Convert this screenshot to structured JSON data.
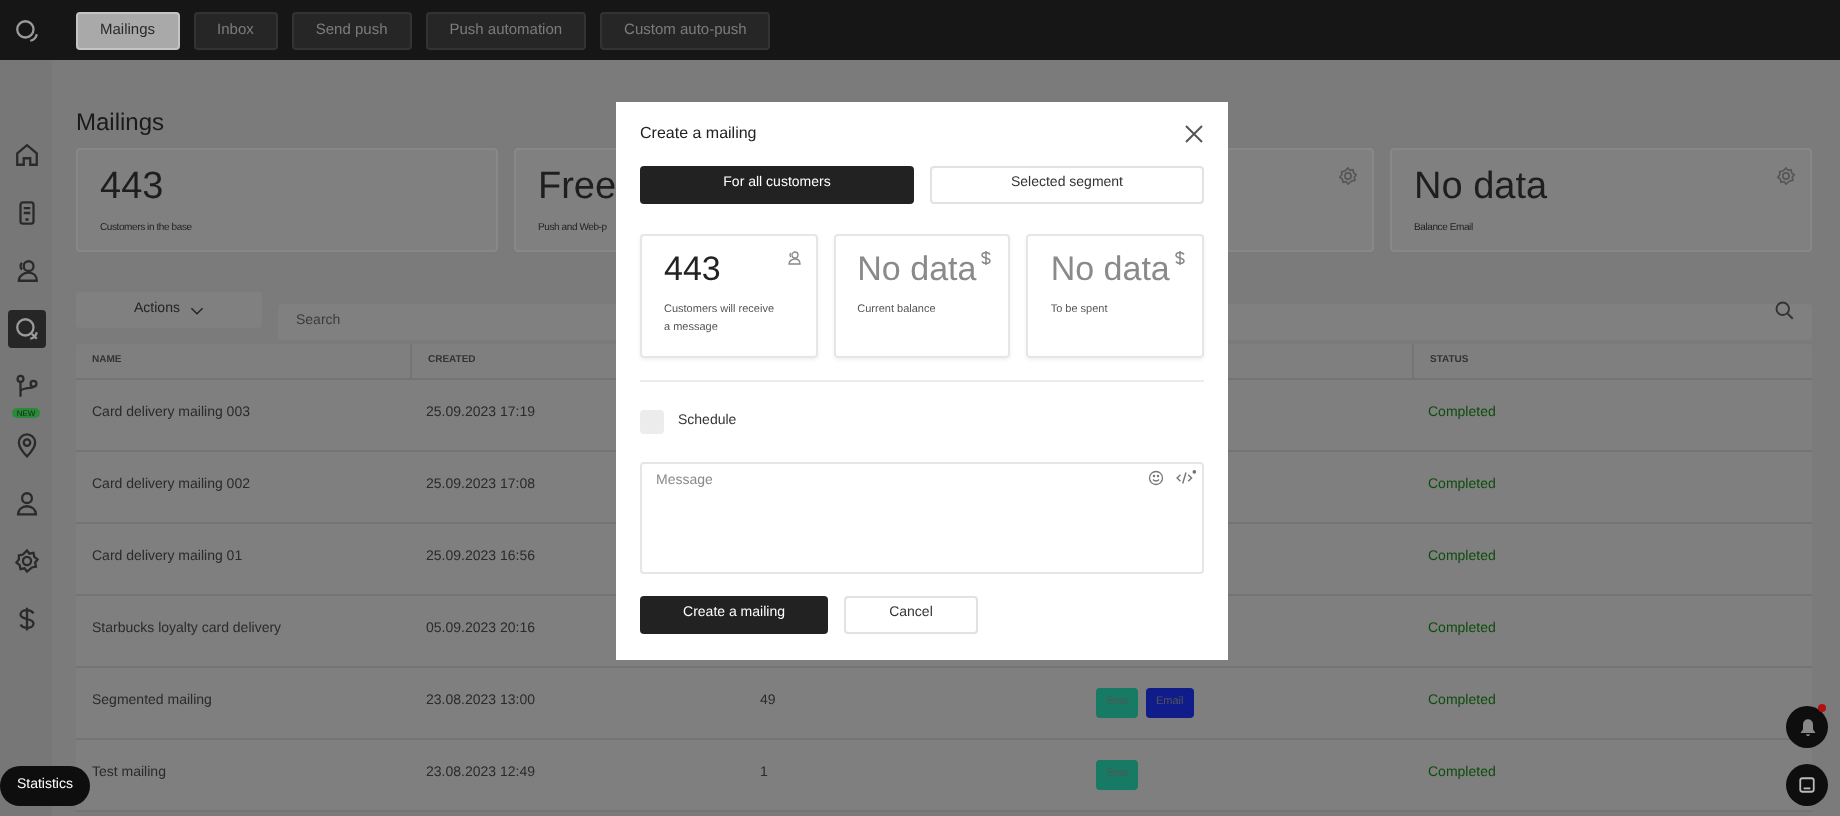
{
  "nav": {
    "tabs": [
      {
        "label": "Mailings",
        "selected": true
      },
      {
        "label": "Inbox",
        "selected": false
      },
      {
        "label": "Send push",
        "selected": false
      },
      {
        "label": "Push automation",
        "selected": false
      },
      {
        "label": "Custom auto-push",
        "selected": false
      }
    ]
  },
  "sidebar": {
    "items": [
      {
        "selected": false
      },
      {
        "selected": false
      },
      {
        "selected": false
      },
      {
        "selected": true
      },
      {
        "selected": false,
        "badge": "NEW"
      },
      {
        "selected": false
      },
      {
        "selected": false
      },
      {
        "selected": false
      },
      {
        "selected": false
      }
    ]
  },
  "page_title": "Mailings",
  "stats": [
    {
      "value": "443",
      "label": "Customers in the base",
      "settings": false
    },
    {
      "value": "Free",
      "label": "Push and Web-p",
      "settings": false
    },
    {
      "settings": true
    },
    {
      "value": "No data",
      "label": "Balance Email",
      "settings": true
    }
  ],
  "actions": {
    "label": "Actions"
  },
  "search": {
    "placeholder": "Search"
  },
  "table": {
    "columns": [
      {
        "label": "NAME"
      },
      {
        "label": "CREATED"
      },
      {
        "label": "STATUS"
      }
    ],
    "rows": [
      {
        "name": "Card delivery mailing 003",
        "created": "25.09.2023 17:19",
        "status": "Completed"
      },
      {
        "name": "Card delivery mailing 002",
        "created": "25.09.2023 17:08",
        "status": "Completed"
      },
      {
        "name": "Card delivery mailing 01",
        "created": "25.09.2023 16:56",
        "status": "Completed"
      },
      {
        "name": "Starbucks loyalty card delivery",
        "created": "05.09.2023 20:16",
        "status": "Completed"
      },
      {
        "name": "Segmented mailing",
        "created": "23.08.2023 13:00",
        "count": "49",
        "channels": [
          {
            "label": "Sms",
            "color": "#167a64"
          },
          {
            "label": "Email",
            "color": "#0f1c8a"
          }
        ],
        "status": "Completed"
      },
      {
        "name": "Test mailing",
        "created": "23.08.2023 12:49",
        "count": "1",
        "channels": [
          {
            "label": "Sms",
            "color": "#167a64"
          }
        ],
        "status": "Completed"
      }
    ]
  },
  "modal": {
    "title": "Create a mailing",
    "audience": [
      {
        "label": "For all customers",
        "selected": true
      },
      {
        "label": "Selected segment",
        "selected": false
      }
    ],
    "cards": [
      {
        "value": "443",
        "label": "Customers will receive a message",
        "kind": "people"
      },
      {
        "value": "No data",
        "label": "Current balance",
        "kind": "money"
      },
      {
        "value": "No data",
        "label": "To be spent",
        "kind": "money"
      }
    ],
    "schedule": {
      "label": "Schedule",
      "checked": false
    },
    "message": {
      "placeholder": "Message"
    },
    "buttons": [
      {
        "label": "Create a mailing",
        "kind": "primary"
      },
      {
        "label": "Cancel",
        "kind": "secondary"
      }
    ]
  },
  "statistics": {
    "label": "Statistics"
  },
  "notifications": {
    "unread": true
  }
}
